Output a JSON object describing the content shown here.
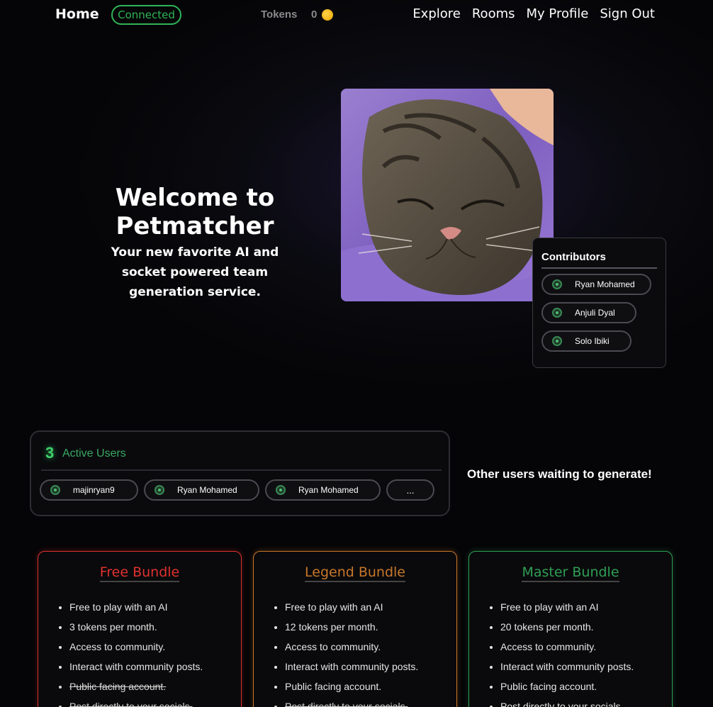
{
  "nav": {
    "home": "Home",
    "status": "Connected",
    "tokens_label": "Tokens",
    "tokens_count": "0",
    "links": [
      "Explore",
      "Rooms",
      "My Profile",
      "Sign Out"
    ]
  },
  "hero": {
    "title": "Welcome to Petmatcher",
    "subtitle": "Your new favorite AI and socket powered team generation service.",
    "image": "sleeping-tabby-cat-photo"
  },
  "contributors": {
    "title": "Contributors",
    "names": [
      "Ryan Mohamed",
      "Anjuli Dyal",
      "Solo Ibiki"
    ]
  },
  "active_users": {
    "count": "3",
    "label": "Active Users",
    "users": [
      "majinryan9",
      "Ryan Mohamed",
      "Ryan Mohamed"
    ],
    "more": "...",
    "waiting_text": "Other users waiting to generate!"
  },
  "bundles": [
    {
      "title": "Free Bundle",
      "color": "#e0312f",
      "features": [
        {
          "text": "Free to play with an AI",
          "included": true
        },
        {
          "text": "3 tokens per month.",
          "included": true
        },
        {
          "text": "Access to community.",
          "included": true
        },
        {
          "text": "Interact with community posts.",
          "included": true
        },
        {
          "text": "Public facing account.",
          "included": false
        },
        {
          "text": "Post directly to your socials.",
          "included": false
        }
      ]
    },
    {
      "title": "Legend Bundle",
      "color": "#c8772a",
      "features": [
        {
          "text": "Free to play with an AI",
          "included": true
        },
        {
          "text": "12 tokens per month.",
          "included": true
        },
        {
          "text": "Access to community.",
          "included": true
        },
        {
          "text": "Interact with community posts.",
          "included": true
        },
        {
          "text": "Public facing account.",
          "included": true
        },
        {
          "text": "Post directly to your socials.",
          "included": false
        }
      ]
    },
    {
      "title": "Master Bundle",
      "color": "#2f9e55",
      "features": [
        {
          "text": "Free to play with an AI",
          "included": true
        },
        {
          "text": "20 tokens per month.",
          "included": true
        },
        {
          "text": "Access to community.",
          "included": true
        },
        {
          "text": "Interact with community posts.",
          "included": true
        },
        {
          "text": "Public facing account.",
          "included": true
        },
        {
          "text": "Post directly to your socials.",
          "included": true
        }
      ]
    }
  ],
  "colors": {
    "accent_green": "#2fb457",
    "coin": "#f2b80f"
  }
}
